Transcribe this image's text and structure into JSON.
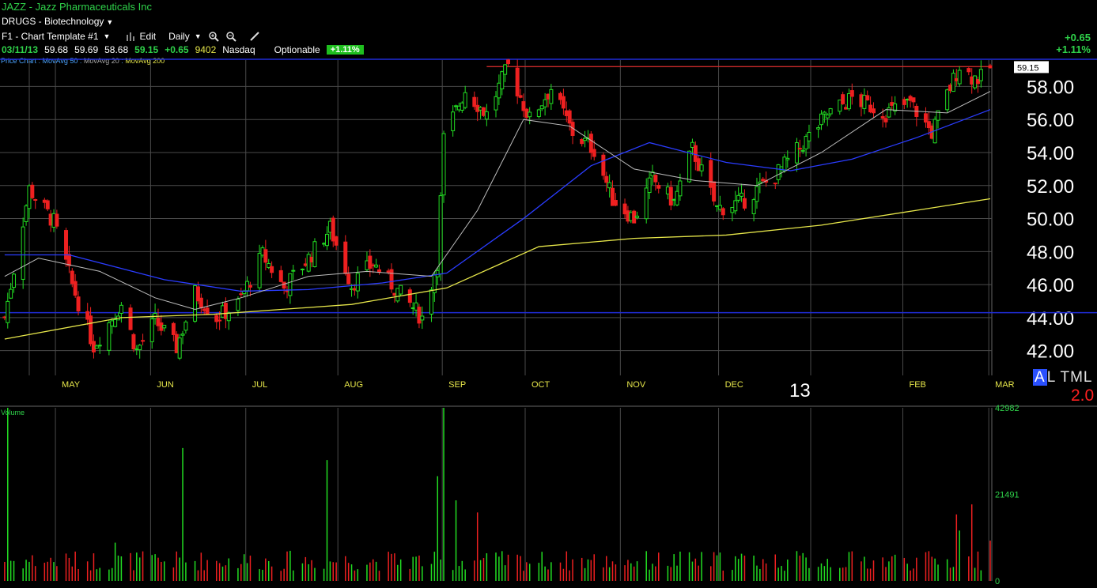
{
  "header": {
    "symbol_line": "JAZZ  - Jazz Pharmaceuticals Inc",
    "industry": "DRUGS - Biotechnology",
    "template": "F1 - Chart Template #1",
    "edit_label": "Edit",
    "interval": "Daily",
    "quote": {
      "date": "03/11/13",
      "open": "59.68",
      "high": "59.69",
      "low": "58.68",
      "close": "59.15",
      "change": "+0.65",
      "volume": "9402",
      "exchange": "Nasdaq",
      "optionable": "Optionable",
      "pct": "+1.11%"
    },
    "top_right_change": "+0.65",
    "top_right_pct": "+1.11%"
  },
  "studies": {
    "label": "Price Chart",
    "ma20": "MovAvg 20",
    "ma50": "MovAvg 50",
    "ma200": "MovAvg 200"
  },
  "logo": {
    "letter": "A",
    "rest": "L TML",
    "version": "2.0"
  },
  "year_label": "13",
  "volume_label": "Volume",
  "colors": {
    "up": "#22dd22",
    "down": "#ee2020",
    "ma20": "#bdbdbd",
    "ma50": "#2a3cff",
    "ma200": "#e6e64a",
    "grid": "#4a4a4a",
    "hline": "#1f2cd8",
    "resistance": "#cc2a2a"
  },
  "chart_data": {
    "type": "candlestick",
    "ylim": [
      40.5,
      59.6
    ],
    "yticks": [
      "42.00",
      "44.00",
      "46.00",
      "48.00",
      "50.00",
      "52.00",
      "54.00",
      "56.00",
      "58.00"
    ],
    "last_price_label": "59.15",
    "months": [
      "MAY",
      "JUN",
      "JUL",
      "AUG",
      "SEP",
      "OCT",
      "NOV",
      "DEC",
      "",
      "FEB",
      "MAR"
    ],
    "horizontal_lines": [
      44.3,
      59.2
    ],
    "ohlc_anchors": [
      [
        "2012-04-24",
        44.0
      ],
      [
        "2012-05-02",
        51.8
      ],
      [
        "2012-05-10",
        49.8
      ],
      [
        "2012-05-16",
        46.0
      ],
      [
        "2012-05-23",
        42.3
      ],
      [
        "2012-06-01",
        44.8
      ],
      [
        "2012-06-06",
        42.0
      ],
      [
        "2012-06-12",
        43.8
      ],
      [
        "2012-06-19",
        42.2
      ],
      [
        "2012-06-25",
        45.5
      ],
      [
        "2012-07-02",
        44.0
      ],
      [
        "2012-07-09",
        44.8
      ],
      [
        "2012-07-17",
        47.8
      ],
      [
        "2012-07-24",
        45.8
      ],
      [
        "2012-08-01",
        47.6
      ],
      [
        "2012-08-08",
        49.4
      ],
      [
        "2012-08-15",
        46.0
      ],
      [
        "2012-08-22",
        47.3
      ],
      [
        "2012-08-29",
        45.8
      ],
      [
        "2012-09-07",
        44.0
      ],
      [
        "2012-09-12",
        47.4
      ],
      [
        "2012-09-14",
        54.8
      ],
      [
        "2012-09-21",
        57.8
      ],
      [
        "2012-09-28",
        56.3
      ],
      [
        "2012-10-05",
        59.2
      ],
      [
        "2012-10-12",
        56.0
      ],
      [
        "2012-10-19",
        57.9
      ],
      [
        "2012-10-26",
        55.2
      ],
      [
        "2012-11-02",
        54.2
      ],
      [
        "2012-11-08",
        51.2
      ],
      [
        "2012-11-15",
        50.0
      ],
      [
        "2012-11-21",
        52.4
      ],
      [
        "2012-11-28",
        51.0
      ],
      [
        "2012-12-04",
        54.2
      ],
      [
        "2012-12-12",
        50.6
      ],
      [
        "2012-12-20",
        51.0
      ],
      [
        "2012-12-31",
        52.6
      ],
      [
        "2013-01-08",
        54.3
      ],
      [
        "2013-01-17",
        56.3
      ],
      [
        "2013-01-25",
        57.3
      ],
      [
        "2013-02-05",
        56.4
      ],
      [
        "2013-02-13",
        57.0
      ],
      [
        "2013-02-20",
        55.2
      ],
      [
        "2013-02-25",
        57.5
      ],
      [
        "2013-03-01",
        59.3
      ],
      [
        "2013-03-05",
        58.6
      ],
      [
        "2013-03-08",
        58.5
      ],
      [
        "2013-03-11",
        59.15
      ]
    ],
    "ma20": [
      [
        "2012-04-24",
        46.5
      ],
      [
        "2012-05-05",
        47.6
      ],
      [
        "2012-05-25",
        46.8
      ],
      [
        "2012-06-12",
        45.2
      ],
      [
        "2012-06-25",
        44.5
      ],
      [
        "2012-07-10",
        45.2
      ],
      [
        "2012-08-01",
        46.5
      ],
      [
        "2012-08-20",
        46.8
      ],
      [
        "2012-09-10",
        46.5
      ],
      [
        "2012-09-25",
        50.5
      ],
      [
        "2012-10-10",
        56.0
      ],
      [
        "2012-10-25",
        55.6
      ],
      [
        "2012-11-15",
        53.0
      ],
      [
        "2012-12-05",
        52.3
      ],
      [
        "2012-12-25",
        52.0
      ],
      [
        "2013-01-15",
        54.0
      ],
      [
        "2013-02-05",
        56.6
      ],
      [
        "2013-02-25",
        56.4
      ],
      [
        "2013-03-11",
        57.7
      ]
    ],
    "ma50": [
      [
        "2012-04-24",
        47.8
      ],
      [
        "2012-05-15",
        47.8
      ],
      [
        "2012-06-15",
        46.3
      ],
      [
        "2012-07-10",
        45.6
      ],
      [
        "2012-08-01",
        45.7
      ],
      [
        "2012-08-25",
        46.1
      ],
      [
        "2012-09-15",
        46.7
      ],
      [
        "2012-10-10",
        50.0
      ],
      [
        "2012-11-01",
        53.2
      ],
      [
        "2012-11-20",
        54.6
      ],
      [
        "2012-12-15",
        53.4
      ],
      [
        "2013-01-05",
        52.9
      ],
      [
        "2013-01-25",
        53.6
      ],
      [
        "2013-02-15",
        54.9
      ],
      [
        "2013-03-11",
        56.6
      ]
    ],
    "ma200": [
      [
        "2012-04-24",
        42.7
      ],
      [
        "2012-06-01",
        44.0
      ],
      [
        "2012-07-01",
        44.2
      ],
      [
        "2012-08-15",
        44.8
      ],
      [
        "2012-09-15",
        45.8
      ],
      [
        "2012-10-15",
        48.3
      ],
      [
        "2012-11-15",
        48.8
      ],
      [
        "2012-12-15",
        49.0
      ],
      [
        "2013-01-15",
        49.6
      ],
      [
        "2013-02-15",
        50.5
      ],
      [
        "2013-03-11",
        51.2
      ]
    ],
    "volume": {
      "ticks": [
        "42982",
        "21491",
        "0"
      ],
      "max": 42982,
      "spikes": [
        [
          "2012-04-25",
          42982
        ],
        [
          "2012-05-30",
          9500
        ],
        [
          "2012-06-21",
          33000
        ],
        [
          "2012-08-07",
          30000
        ],
        [
          "2012-09-12",
          26000
        ],
        [
          "2012-09-14",
          42982
        ],
        [
          "2012-09-18",
          20000
        ],
        [
          "2012-09-25",
          17000
        ],
        [
          "2013-02-28",
          16500
        ],
        [
          "2013-03-01",
          12500
        ],
        [
          "2013-03-05",
          19000
        ],
        [
          "2013-03-11",
          10000
        ]
      ]
    }
  }
}
